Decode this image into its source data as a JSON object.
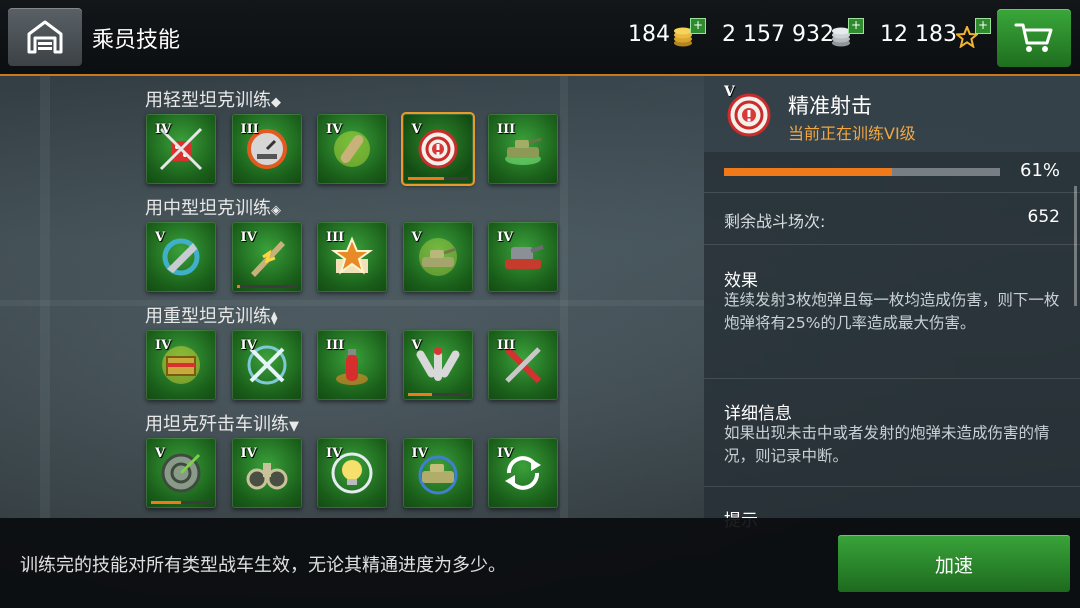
{
  "header": {
    "title": "乘员技能",
    "home_icon": "garage-icon",
    "resources": {
      "gold": {
        "value": "184",
        "icon": "gold-coins-icon"
      },
      "silver": {
        "value": "2 157 932",
        "icon": "silver-coins-icon"
      },
      "stars": {
        "value": "12 183",
        "icon": "star-icon"
      }
    },
    "plus_symbol": "+",
    "cart_icon": "shopping-cart-icon"
  },
  "sections": [
    {
      "label": "用轻型坦克训练",
      "class_icon": "light-tank-class-icon",
      "skills": [
        {
          "level": "IV",
          "icon": "dice-crossed-icon",
          "progress": null
        },
        {
          "level": "III",
          "icon": "gauge-arrows-icon",
          "progress": null
        },
        {
          "level": "IV",
          "icon": "shell-burst-icon",
          "progress": null
        },
        {
          "level": "V",
          "icon": "target-alert-icon",
          "progress": 0.61,
          "selected": true
        },
        {
          "level": "III",
          "icon": "tank-glow-icon",
          "progress": null
        }
      ]
    },
    {
      "label": "用中型坦克训练",
      "class_icon": "medium-tank-class-icon",
      "skills": [
        {
          "level": "V",
          "icon": "drill-shell-icon",
          "progress": null
        },
        {
          "level": "IV",
          "icon": "shell-impact-icon",
          "progress": 0.05
        },
        {
          "level": "III",
          "icon": "star-medal-icon",
          "progress": null
        },
        {
          "level": "V",
          "icon": "tank-shield-icon",
          "progress": null
        },
        {
          "level": "IV",
          "icon": "turret-armor-icon",
          "progress": null
        }
      ]
    },
    {
      "label": "用重型坦克训练",
      "class_icon": "heavy-tank-class-icon",
      "skills": [
        {
          "level": "IV",
          "icon": "armor-crate-icon",
          "progress": null
        },
        {
          "level": "IV",
          "icon": "crossed-swords-icon",
          "progress": null
        },
        {
          "level": "III",
          "icon": "fire-extinguisher-icon",
          "progress": null
        },
        {
          "level": "V",
          "icon": "shells-spread-icon",
          "progress": 0.4
        },
        {
          "level": "III",
          "icon": "repair-tools-icon",
          "progress": null
        }
      ]
    },
    {
      "label": "用坦克歼击车训练",
      "class_icon": "tank-destroyer-class-icon",
      "skills": [
        {
          "level": "V",
          "icon": "bullseye-dart-icon",
          "progress": 0.5
        },
        {
          "level": "IV",
          "icon": "binoculars-icon",
          "progress": null
        },
        {
          "level": "IV",
          "icon": "lightbulb-icon",
          "progress": null
        },
        {
          "level": "IV",
          "icon": "tank-rotate-icon",
          "progress": null
        },
        {
          "level": "IV",
          "icon": "reload-cycle-icon",
          "progress": null
        }
      ]
    }
  ],
  "detail": {
    "level": "V",
    "badge_icon": "target-alert-icon",
    "title": "精准射击",
    "subtitle": "当前正在训练VI级",
    "progress": 0.61,
    "progress_text": "61%",
    "battles_label": "剩余战斗场次:",
    "battles_value": "652",
    "effect_title": "效果",
    "effect_body": "连续发射3枚炮弹且每一枚均造成伤害，则下一枚炮弹将有25%的几率造成最大伤害。",
    "info_title": "详细信息",
    "info_body": "如果出现未击中或者发射的炮弹未造成伤害的情况，则记录中断。",
    "tips_title": "提示"
  },
  "footer": {
    "note": "训练完的技能对所有类型战车生效，无论其精通进度为多少。",
    "speed_button": "加速"
  },
  "colors": {
    "accent_orange": "#f07a1a",
    "tile_green": "#2e8a2e",
    "button_green": "#39a43a",
    "subtitle_orange": "#f2a640"
  }
}
